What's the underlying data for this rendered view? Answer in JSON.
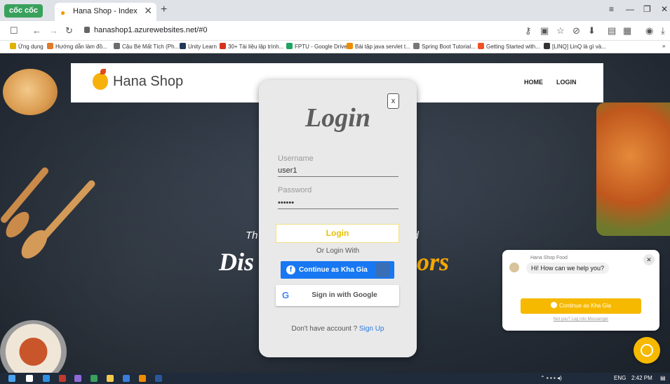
{
  "browser": {
    "brand": "cốc cốc",
    "tab_title": "Hana Shop - Index",
    "tab_close": "✕",
    "new_tab": "+",
    "url": "hanashop1.azurewebsites.net/#0",
    "bookmarks": [
      "Ứng dụng",
      "Hướng dẫn làm đồ...",
      "Cậu Bé Mất Tích (Ph...",
      "Unity Learn",
      "30+ Tài liệu lập trình...",
      "FPTU - Google Drive",
      "Bài tập java servlet t...",
      "Spring Boot Tutorial...",
      "Getting Started with...",
      "[LINQ] LinQ là gì và..."
    ],
    "bookmarks_more": "»"
  },
  "site": {
    "logo_text": "Hana Shop",
    "nav": [
      "HOME",
      "LOGIN"
    ]
  },
  "hero": {
    "small_left": "Th",
    "small_right": "rld",
    "big_left": "Dis",
    "big_right": "ors"
  },
  "login": {
    "close": "x",
    "title": "Login",
    "username_label": "Username",
    "username_value": "user1",
    "password_label": "Password",
    "password_value": "••••••",
    "login_button": "Login",
    "or_text": "Or Login With",
    "facebook_button": "Continue as Kha Gia",
    "google_button": "Sign in with Google",
    "signup_prompt": "Don't have account ?",
    "signup_link": "Sign Up"
  },
  "chat": {
    "page_name": "Hana Shop Food",
    "greeting": "Hi! How can we help you?",
    "close": "✕",
    "continue_button": "Continue as Kha Gia",
    "not_you": "Not you? Log into Messenger"
  },
  "taskbar": {
    "lang": "ENG",
    "time": "2:42 PM"
  },
  "colors": {
    "accent_yellow": "#f6b900",
    "facebook_blue": "#1877f2",
    "link_blue": "#2a7ae2"
  }
}
